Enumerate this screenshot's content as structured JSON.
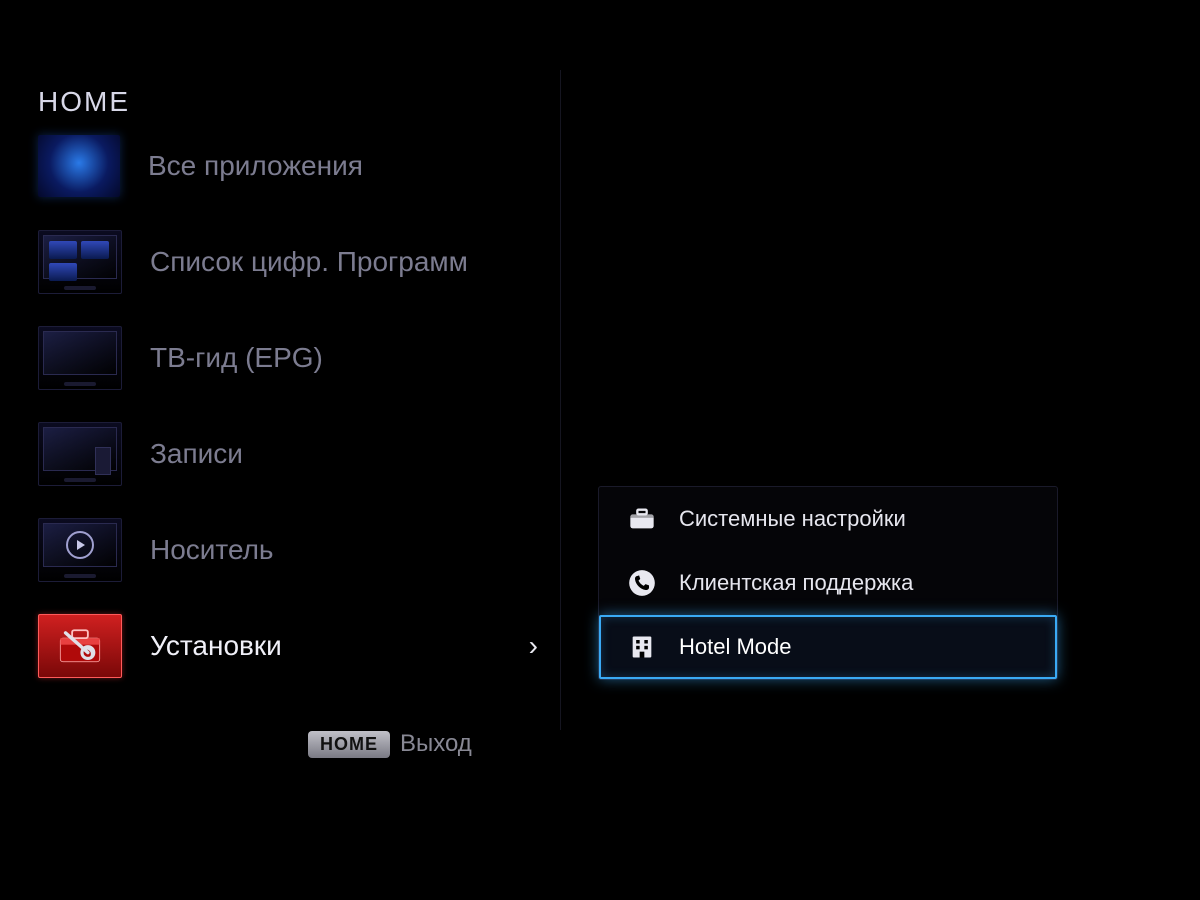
{
  "title": "HOME",
  "main_items": [
    {
      "label": "Все приложения",
      "icon": "globe",
      "selected": false
    },
    {
      "label": "Список цифр. Программ",
      "icon": "channels",
      "selected": false
    },
    {
      "label": "ТВ-гид (EPG)",
      "icon": "epg",
      "selected": false
    },
    {
      "label": "Записи",
      "icon": "records",
      "selected": false
    },
    {
      "label": "Носитель",
      "icon": "media",
      "selected": false
    },
    {
      "label": "Установки",
      "icon": "settings",
      "selected": true
    }
  ],
  "sub_items": [
    {
      "label": "Системные настройки",
      "icon": "toolbox",
      "highlight": false
    },
    {
      "label": "Клиентская поддержка",
      "icon": "phone",
      "highlight": false
    },
    {
      "label": "Hotel Mode",
      "icon": "building",
      "highlight": true
    }
  ],
  "footer": {
    "key": "HOME",
    "action": "Выход"
  }
}
